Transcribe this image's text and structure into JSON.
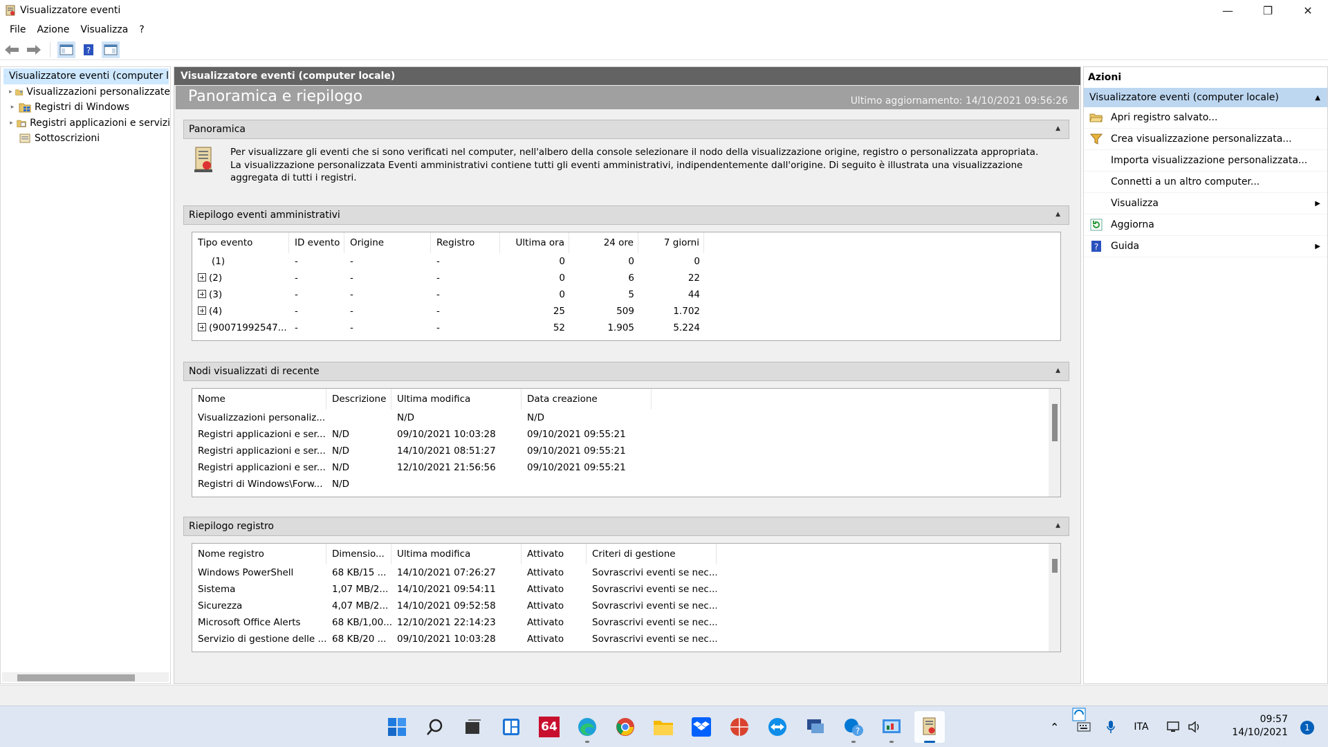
{
  "window": {
    "title": "Visualizzatore eventi",
    "controls": {
      "minimize": "—",
      "restore": "❐",
      "close": "✕"
    }
  },
  "menu": [
    "File",
    "Azione",
    "Visualizza",
    "?"
  ],
  "tree": {
    "root": "Visualizzatore eventi (computer l",
    "items": [
      {
        "label": "Visualizzazioni personalizzate",
        "icon": "folder-filter-icon"
      },
      {
        "label": "Registri di Windows",
        "icon": "windows-logs-icon"
      },
      {
        "label": "Registri applicazioni e servizi",
        "icon": "app-logs-icon"
      },
      {
        "label": "Sottoscrizioni",
        "icon": "subscriptions-icon"
      }
    ]
  },
  "center": {
    "header": "Visualizzatore eventi (computer locale)",
    "banner_title": "Panoramica e riepilogo",
    "banner_updated": "Ultimo aggiornamento: 14/10/2021 09:56:26",
    "overview": {
      "title": "Panoramica",
      "text": "Per visualizzare gli eventi che si sono verificati nel computer, nell'albero della console selezionare il nodo della visualizzazione origine, registro o personalizzata appropriata. La visualizzazione personalizzata Eventi amministrativi contiene tutti gli eventi amministrativi, indipendentemente dall'origine. Di seguito è illustrata una visualizzazione aggregata di tutti i registri."
    },
    "admin_summary": {
      "title": "Riepilogo eventi amministrativi",
      "columns": [
        "Tipo evento",
        "ID evento",
        "Origine",
        "Registro",
        "Ultima ora",
        "24 ore",
        "7 giorni"
      ],
      "rows": [
        {
          "type": "(1)",
          "expand": false,
          "id": "-",
          "origin": "-",
          "log": "-",
          "hour": "0",
          "day": "0",
          "week": "0"
        },
        {
          "type": "(2)",
          "expand": true,
          "id": "-",
          "origin": "-",
          "log": "-",
          "hour": "0",
          "day": "6",
          "week": "22"
        },
        {
          "type": "(3)",
          "expand": true,
          "id": "-",
          "origin": "-",
          "log": "-",
          "hour": "0",
          "day": "5",
          "week": "44"
        },
        {
          "type": "(4)",
          "expand": true,
          "id": "-",
          "origin": "-",
          "log": "-",
          "hour": "25",
          "day": "509",
          "week": "1.702"
        },
        {
          "type": "(90071992547...",
          "expand": true,
          "id": "-",
          "origin": "-",
          "log": "-",
          "hour": "52",
          "day": "1.905",
          "week": "5.224"
        }
      ]
    },
    "recent": {
      "title": "Nodi visualizzati di recente",
      "columns": [
        "Nome",
        "Descrizione",
        "Ultima modifica",
        "Data creazione"
      ],
      "rows": [
        [
          "Visualizzazioni personaliz...",
          "",
          "N/D",
          "N/D"
        ],
        [
          "Registri applicazioni e ser...",
          "N/D",
          "09/10/2021 10:03:28",
          "09/10/2021 09:55:21"
        ],
        [
          "Registri applicazioni e ser...",
          "N/D",
          "14/10/2021 08:51:27",
          "09/10/2021 09:55:21"
        ],
        [
          "Registri applicazioni e ser...",
          "N/D",
          "12/10/2021 21:56:56",
          "09/10/2021 09:55:21"
        ],
        [
          "Registri di Windows\\Forw...",
          "N/D",
          "",
          ""
        ]
      ]
    },
    "log_summary": {
      "title": "Riepilogo registro",
      "columns": [
        "Nome registro",
        "Dimensio...",
        "Ultima modifica",
        "Attivato",
        "Criteri di gestione"
      ],
      "rows": [
        [
          "Windows PowerShell",
          "68 KB/15 ...",
          "14/10/2021 07:26:27",
          "Attivato",
          "Sovrascrivi eventi se nec..."
        ],
        [
          "Sistema",
          "1,07 MB/2...",
          "14/10/2021 09:54:11",
          "Attivato",
          "Sovrascrivi eventi se nec..."
        ],
        [
          "Sicurezza",
          "4,07 MB/2...",
          "14/10/2021 09:52:58",
          "Attivato",
          "Sovrascrivi eventi se nec..."
        ],
        [
          "Microsoft Office Alerts",
          "68 KB/1,00...",
          "12/10/2021 22:14:23",
          "Attivato",
          "Sovrascrivi eventi se nec..."
        ],
        [
          "Servizio di gestione delle ...",
          "68 KB/20 ...",
          "09/10/2021 10:03:28",
          "Attivato",
          "Sovrascrivi eventi se nec..."
        ]
      ]
    }
  },
  "actions": {
    "title": "Azioni",
    "subtitle": "Visualizzatore eventi (computer locale)",
    "items": [
      {
        "label": "Apri registro salvato...",
        "icon": "open-folder-icon",
        "submenu": false
      },
      {
        "label": "Crea visualizzazione personalizzata...",
        "icon": "filter-icon",
        "submenu": false
      },
      {
        "label": "Importa visualizzazione personalizzata...",
        "icon": "",
        "submenu": false
      },
      {
        "label": "Connetti a un altro computer...",
        "icon": "",
        "submenu": false
      },
      {
        "label": "Visualizza",
        "icon": "",
        "submenu": true
      },
      {
        "label": "Aggiorna",
        "icon": "refresh-icon",
        "submenu": false
      },
      {
        "label": "Guida",
        "icon": "help-icon",
        "submenu": true
      }
    ]
  },
  "taskbar": {
    "badge64": "64",
    "tray_lang": "ITA",
    "time": "09:57",
    "date": "14/10/2021",
    "notifications": "1"
  },
  "colors": {
    "accent": "#005fb8",
    "selection": "#cde8ff",
    "header_dark": "#636363",
    "banner": "#a0a0a0"
  }
}
